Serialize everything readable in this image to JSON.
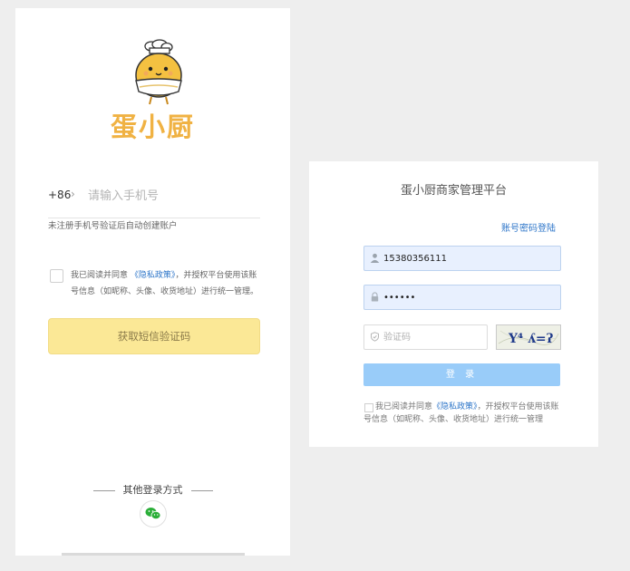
{
  "mobile_login": {
    "brand_name": "蛋小厨",
    "country_code": "+86",
    "country_chevron": "›",
    "phone_placeholder": "请输入手机号",
    "unregistered_hint": "未注册手机号验证后自动创建账户",
    "agreement_prefix": "我已阅读并同意",
    "privacy_policy_link": "《隐私政策》",
    "agreement_suffix": "，并授权平台使用该账号信息（如昵称、头像、收货地址）进行统一管理。",
    "get_sms_code_button": "获取短信验证码",
    "other_login_methods": "其他登录方式",
    "icons": [
      "mascot-logo",
      "checkbox",
      "wechat-icon"
    ],
    "colors": {
      "brand": "#f0b243",
      "button": "#fbe896",
      "link": "#2e76c9"
    }
  },
  "admin_login": {
    "title": "蛋小厨商家管理平台",
    "switch_login_link": "账号密码登陆",
    "username_value": "15380356111",
    "password_value": "••••••",
    "captcha_placeholder": "验证码",
    "captcha_text": "Y⁴ ʎ=ʔ",
    "login_button": "登 录",
    "agreement_prefix": "我已阅读并同意",
    "privacy_policy_link": "《隐私政策》",
    "agreement_suffix": "，开授权平台使用该账号信息（如昵称、头像、收货地址）进行统一管理",
    "icons": [
      "user-icon",
      "lock-icon",
      "shield-icon",
      "checkbox"
    ],
    "colors": {
      "login_button": "#99ccf9",
      "field_bg": "#e8f0fe",
      "link": "#2e76c9"
    }
  }
}
